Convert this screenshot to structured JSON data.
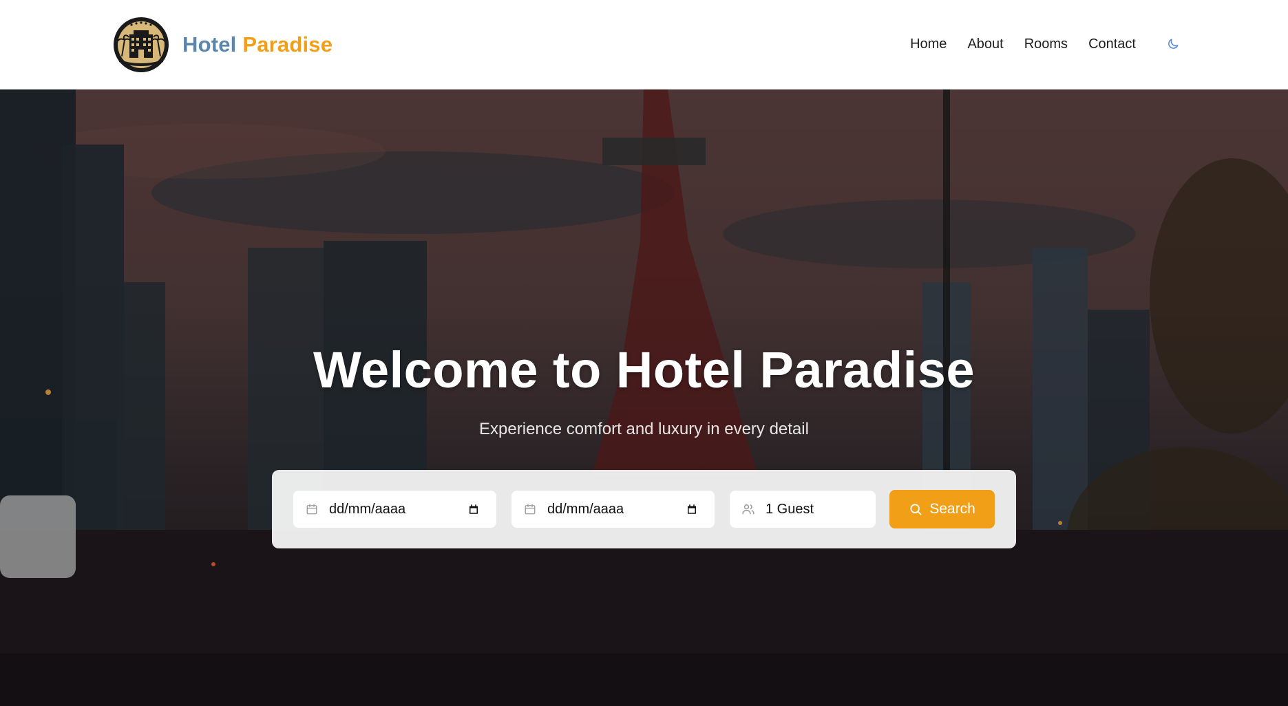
{
  "brand": {
    "name_part1": "Hotel",
    "name_part2": "Paradise",
    "color_primary": "#5a86ad",
    "color_accent": "#f29f18"
  },
  "nav": {
    "items": [
      {
        "label": "Home"
      },
      {
        "label": "About"
      },
      {
        "label": "Rooms"
      },
      {
        "label": "Contact"
      }
    ],
    "theme_toggle_icon": "moon-icon"
  },
  "hero": {
    "title": "Welcome to Hotel Paradise",
    "subtitle": "Experience comfort and luxury in every detail"
  },
  "booking": {
    "checkin": {
      "value": "dd/mm/aaaa",
      "icon": "calendar-icon"
    },
    "checkout": {
      "value": "dd/mm/aaaa",
      "icon": "calendar-icon"
    },
    "guests": {
      "value": "1 Guest",
      "icon": "users-icon"
    },
    "search_label": "Search",
    "search_icon": "search-icon"
  }
}
